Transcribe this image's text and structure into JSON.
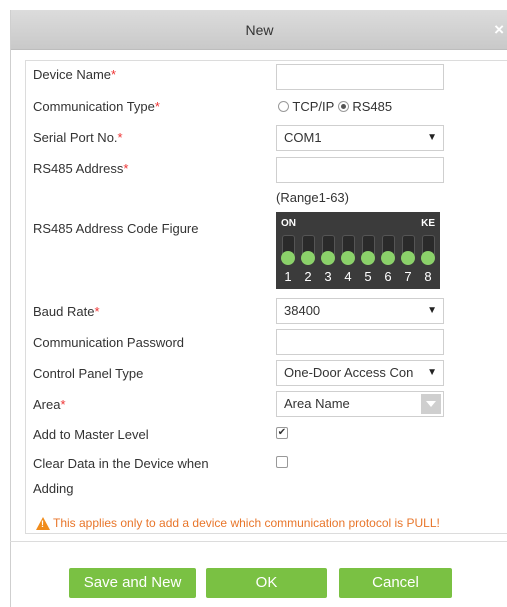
{
  "dialog": {
    "title": "New",
    "close_icon": "×"
  },
  "form": {
    "device_name": {
      "label": "Device Name",
      "required": "*",
      "value": ""
    },
    "communication_type": {
      "label": "Communication Type",
      "required": "*",
      "options": [
        "TCP/IP",
        "RS485"
      ],
      "selected": "RS485"
    },
    "serial_port": {
      "label": "Serial Port No.",
      "required": "*",
      "value": "COM1"
    },
    "rs485_address": {
      "label": "RS485 Address",
      "required": "*",
      "value": "",
      "hint": "(Range1-63)"
    },
    "address_code_figure": {
      "label": "RS485 Address Code Figure",
      "on_label": "ON",
      "ke_label": "KE",
      "switch_numbers": [
        "1",
        "2",
        "3",
        "4",
        "5",
        "6",
        "7",
        "8"
      ]
    },
    "baud_rate": {
      "label": "Baud Rate",
      "required": "*",
      "value": "38400"
    },
    "comm_password": {
      "label": "Communication Password",
      "value": ""
    },
    "control_panel_type": {
      "label": "Control Panel Type",
      "value": "One-Door Access Con"
    },
    "area": {
      "label": "Area",
      "required": "*",
      "value": "Area Name"
    },
    "add_to_master_level": {
      "label": "Add to Master Level",
      "checked": true
    },
    "clear_data": {
      "label_line1": "Clear Data in the Device when",
      "label_line2": "Adding",
      "checked": false
    }
  },
  "warning": {
    "text": "This applies only to add a device which communication protocol is PULL!",
    "icon": "warning-triangle-icon",
    "color": "#e8762b"
  },
  "buttons": {
    "save_and_new": "Save and New",
    "ok": "OK",
    "cancel": "Cancel",
    "color": "#7ac143"
  }
}
